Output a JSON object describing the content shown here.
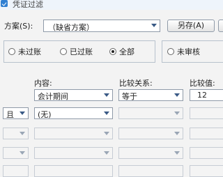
{
  "window": {
    "title": "凭证过滤"
  },
  "scheme": {
    "label": "方案(S):",
    "value": "（缺省方案）",
    "save_as_button": "另存(A)"
  },
  "posting_status": {
    "options": [
      "未过账",
      "已过账",
      "全部"
    ],
    "selected": "全部"
  },
  "audit_status": {
    "options": [
      "未审核"
    ],
    "selected": ""
  },
  "filter": {
    "headers": {
      "content": "内容:",
      "compare": "比较关系:",
      "value": "比较值:"
    },
    "first_row": {
      "content": "会计期间",
      "compare": "等于",
      "value": "12"
    },
    "rows": [
      {
        "logic": "且",
        "content": "(无)",
        "compare": "",
        "value": ""
      },
      {
        "logic": "",
        "content": "",
        "compare": "",
        "value": ""
      },
      {
        "logic": "",
        "content": "",
        "compare": "",
        "value": ""
      },
      {
        "logic": "",
        "content": "",
        "compare": "",
        "value": ""
      }
    ]
  }
}
